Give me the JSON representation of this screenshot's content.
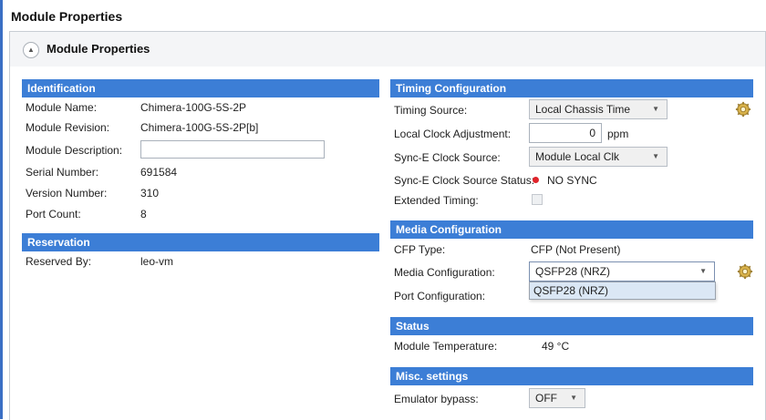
{
  "page_title": "Module Properties",
  "panel": {
    "title": "Module Properties",
    "collapse_glyph": "▲"
  },
  "identification": {
    "header": "Identification",
    "module_name_label": "Module Name:",
    "module_name": "Chimera-100G-5S-2P",
    "module_revision_label": "Module Revision:",
    "module_revision": "Chimera-100G-5S-2P[b]",
    "module_description_label": "Module Description:",
    "module_description": "",
    "serial_number_label": "Serial Number:",
    "serial_number": "691584",
    "version_number_label": "Version Number:",
    "version_number": "310",
    "port_count_label": "Port Count:",
    "port_count": "8"
  },
  "reservation": {
    "header": "Reservation",
    "reserved_by_label": "Reserved By:",
    "reserved_by": "leo-vm"
  },
  "timing": {
    "header": "Timing Configuration",
    "timing_source_label": "Timing Source:",
    "timing_source": "Local Chassis Time",
    "local_clock_label": "Local Clock Adjustment:",
    "local_clock_value": "0",
    "local_clock_unit": "ppm",
    "synce_source_label": "Sync-E Clock Source:",
    "synce_source": "Module Local Clk",
    "synce_status_label": "Sync-E Clock Source Status:",
    "synce_status": "NO SYNC",
    "extended_timing_label": "Extended Timing:"
  },
  "media": {
    "header": "Media Configuration",
    "cfp_type_label": "CFP Type:",
    "cfp_type": "CFP (Not Present)",
    "media_config_label": "Media Configuration:",
    "media_config": "QSFP28 (NRZ)",
    "dropdown_options": [
      "QSFP28 (NRZ)"
    ],
    "port_config_label": "Port Configuration:"
  },
  "status": {
    "header": "Status",
    "module_temp_label": "Module Temperature:",
    "module_temp": "49 °C"
  },
  "misc": {
    "header": "Misc. settings",
    "emulator_bypass_label": "Emulator bypass:",
    "emulator_bypass": "OFF"
  },
  "colors": {
    "section_header": "#3c7ed6",
    "status_dot": "#e0242b",
    "left_bar": "#3a6fc4"
  },
  "icons": {
    "gear": "gear-icon",
    "caret": "chevron-down-icon",
    "collapse": "chevron-up-icon"
  }
}
